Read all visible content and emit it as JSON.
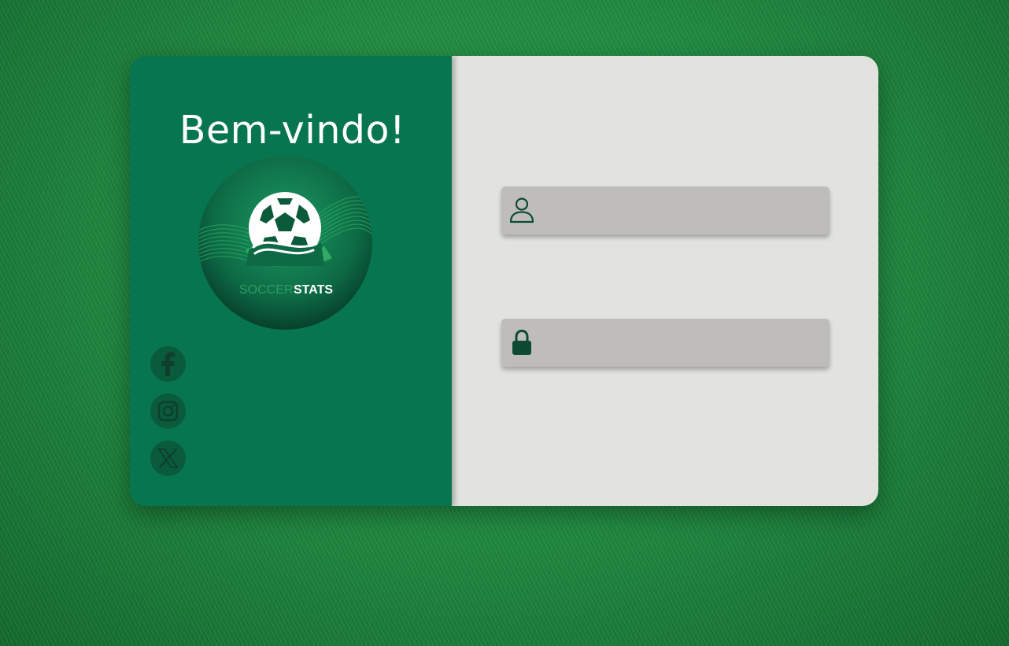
{
  "welcome_title": "Bem-vindo!",
  "logo": {
    "text_part1": "SOCCER",
    "text_part2": "STATS",
    "icon": "soccer-ball-logo"
  },
  "social": [
    {
      "name": "facebook",
      "icon": "facebook-icon"
    },
    {
      "name": "instagram",
      "icon": "instagram-icon"
    },
    {
      "name": "x",
      "icon": "x-icon"
    }
  ],
  "form": {
    "username": {
      "icon": "user-icon",
      "value": "",
      "placeholder": ""
    },
    "password": {
      "icon": "lock-icon",
      "value": "",
      "placeholder": ""
    }
  },
  "colors": {
    "panel_green": "#077550",
    "form_background": "#e2e3df",
    "field_background": "#bebdbb",
    "icon_dark_green": "#0c4a33"
  }
}
